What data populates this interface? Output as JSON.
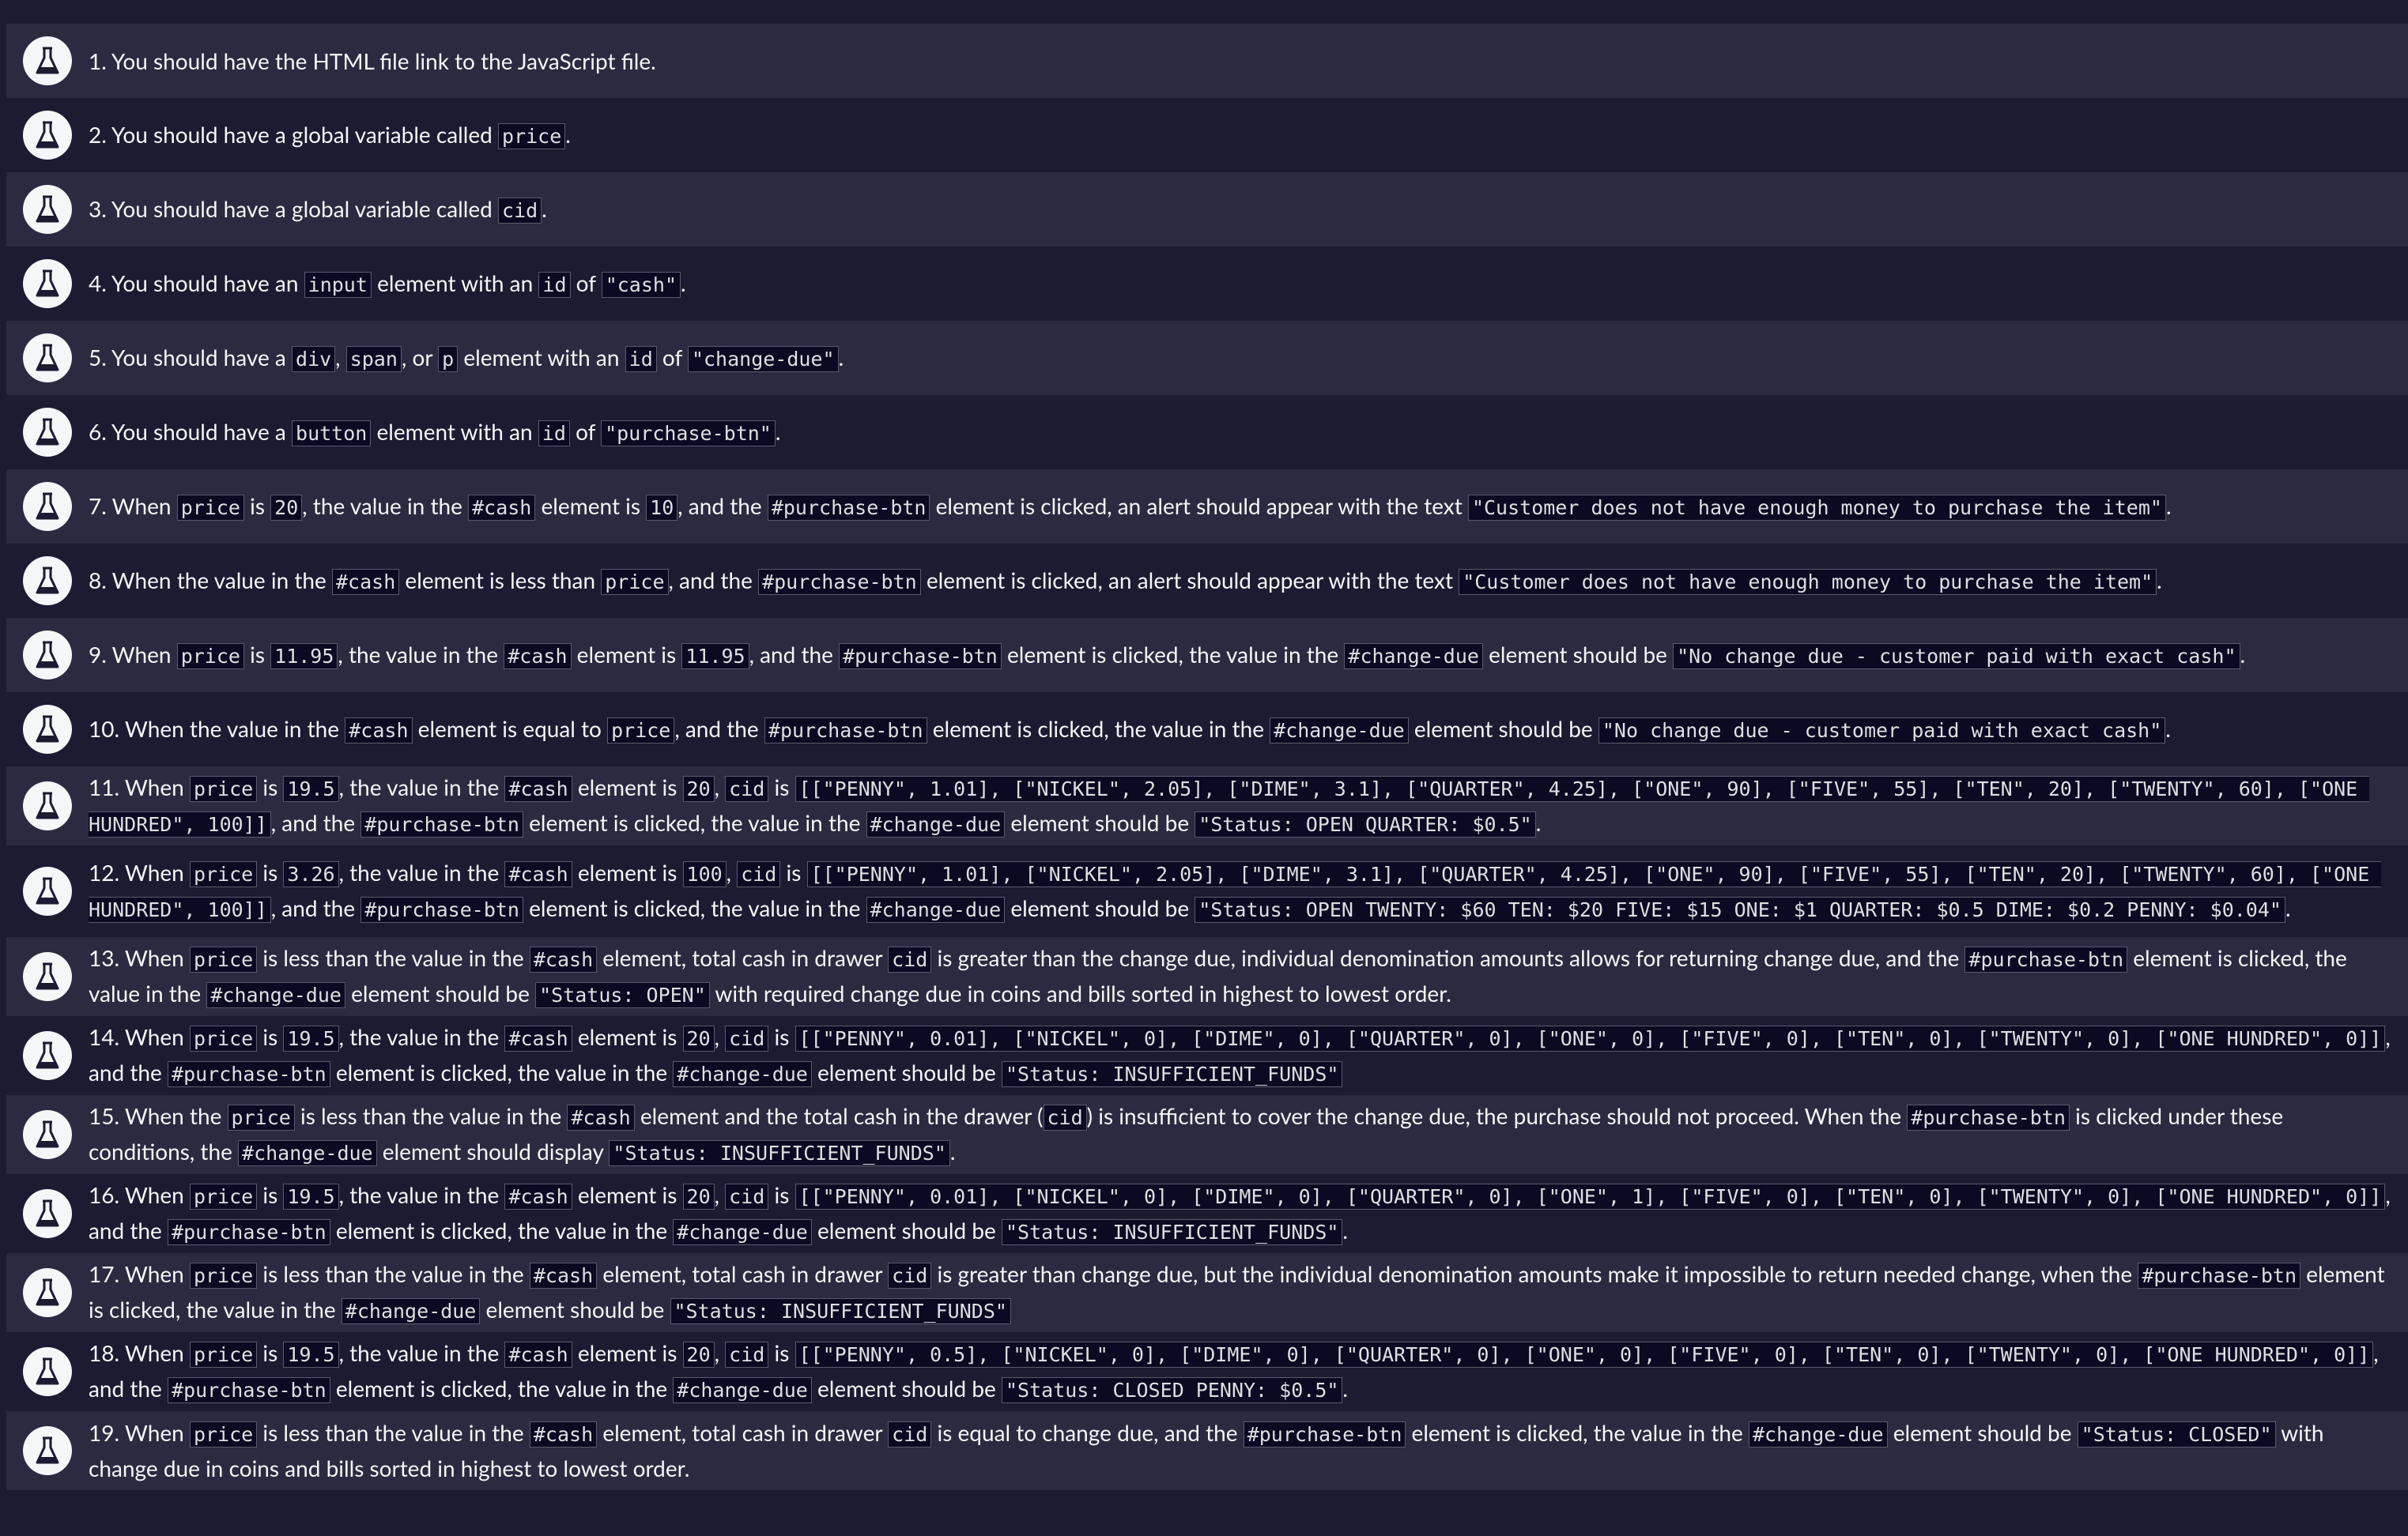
{
  "tests": [
    {
      "parts": [
        {
          "t": "text",
          "v": "1. You should have the HTML file link to the JavaScript file."
        }
      ]
    },
    {
      "parts": [
        {
          "t": "text",
          "v": "2. You should have a global variable called "
        },
        {
          "t": "code",
          "v": "price"
        },
        {
          "t": "text",
          "v": "."
        }
      ]
    },
    {
      "parts": [
        {
          "t": "text",
          "v": "3. You should have a global variable called "
        },
        {
          "t": "code",
          "v": "cid"
        },
        {
          "t": "text",
          "v": "."
        }
      ]
    },
    {
      "parts": [
        {
          "t": "text",
          "v": "4. You should have an "
        },
        {
          "t": "code",
          "v": "input"
        },
        {
          "t": "text",
          "v": " element with an "
        },
        {
          "t": "code",
          "v": "id"
        },
        {
          "t": "text",
          "v": " of "
        },
        {
          "t": "code",
          "v": "\"cash\""
        },
        {
          "t": "text",
          "v": "."
        }
      ]
    },
    {
      "parts": [
        {
          "t": "text",
          "v": "5. You should have a "
        },
        {
          "t": "code",
          "v": "div"
        },
        {
          "t": "text",
          "v": ", "
        },
        {
          "t": "code",
          "v": "span"
        },
        {
          "t": "text",
          "v": ", or "
        },
        {
          "t": "code",
          "v": "p"
        },
        {
          "t": "text",
          "v": " element with an "
        },
        {
          "t": "code",
          "v": "id"
        },
        {
          "t": "text",
          "v": " of "
        },
        {
          "t": "code",
          "v": "\"change-due\""
        },
        {
          "t": "text",
          "v": "."
        }
      ]
    },
    {
      "parts": [
        {
          "t": "text",
          "v": "6. You should have a "
        },
        {
          "t": "code",
          "v": "button"
        },
        {
          "t": "text",
          "v": " element with an "
        },
        {
          "t": "code",
          "v": "id"
        },
        {
          "t": "text",
          "v": " of "
        },
        {
          "t": "code",
          "v": "\"purchase-btn\""
        },
        {
          "t": "text",
          "v": "."
        }
      ]
    },
    {
      "parts": [
        {
          "t": "text",
          "v": "7. When "
        },
        {
          "t": "code",
          "v": "price"
        },
        {
          "t": "text",
          "v": " is "
        },
        {
          "t": "code",
          "v": "20"
        },
        {
          "t": "text",
          "v": ", the value in the "
        },
        {
          "t": "code",
          "v": "#cash"
        },
        {
          "t": "text",
          "v": " element is "
        },
        {
          "t": "code",
          "v": "10"
        },
        {
          "t": "text",
          "v": ", and the "
        },
        {
          "t": "code",
          "v": "#purchase-btn"
        },
        {
          "t": "text",
          "v": " element is clicked, an alert should appear with the text "
        },
        {
          "t": "code",
          "v": "\"Customer does not have enough money to purchase the item\""
        },
        {
          "t": "text",
          "v": "."
        }
      ]
    },
    {
      "parts": [
        {
          "t": "text",
          "v": "8. When the value in the "
        },
        {
          "t": "code",
          "v": "#cash"
        },
        {
          "t": "text",
          "v": " element is less than "
        },
        {
          "t": "code",
          "v": "price"
        },
        {
          "t": "text",
          "v": ", and the "
        },
        {
          "t": "code",
          "v": "#purchase-btn"
        },
        {
          "t": "text",
          "v": " element is clicked, an alert should appear with the text "
        },
        {
          "t": "code",
          "v": "\"Customer does not have enough money to purchase the item\""
        },
        {
          "t": "text",
          "v": "."
        }
      ]
    },
    {
      "parts": [
        {
          "t": "text",
          "v": "9. When "
        },
        {
          "t": "code",
          "v": "price"
        },
        {
          "t": "text",
          "v": " is "
        },
        {
          "t": "code",
          "v": "11.95"
        },
        {
          "t": "text",
          "v": ", the value in the "
        },
        {
          "t": "code",
          "v": "#cash"
        },
        {
          "t": "text",
          "v": " element is "
        },
        {
          "t": "code",
          "v": "11.95"
        },
        {
          "t": "text",
          "v": ", and the "
        },
        {
          "t": "code",
          "v": "#purchase-btn"
        },
        {
          "t": "text",
          "v": " element is clicked, the value in the "
        },
        {
          "t": "code",
          "v": "#change-due"
        },
        {
          "t": "text",
          "v": " element should be "
        },
        {
          "t": "code",
          "v": "\"No change due - customer paid with exact cash\""
        },
        {
          "t": "text",
          "v": "."
        }
      ]
    },
    {
      "parts": [
        {
          "t": "text",
          "v": "10. When the value in the "
        },
        {
          "t": "code",
          "v": "#cash"
        },
        {
          "t": "text",
          "v": " element is equal to "
        },
        {
          "t": "code",
          "v": "price"
        },
        {
          "t": "text",
          "v": ", and the "
        },
        {
          "t": "code",
          "v": "#purchase-btn"
        },
        {
          "t": "text",
          "v": " element is clicked, the value in the "
        },
        {
          "t": "code",
          "v": "#change-due"
        },
        {
          "t": "text",
          "v": " element should be "
        },
        {
          "t": "code",
          "v": "\"No change due - customer paid with exact cash\""
        },
        {
          "t": "text",
          "v": "."
        }
      ]
    },
    {
      "parts": [
        {
          "t": "text",
          "v": "11. When "
        },
        {
          "t": "code",
          "v": "price"
        },
        {
          "t": "text",
          "v": " is "
        },
        {
          "t": "code",
          "v": "19.5"
        },
        {
          "t": "text",
          "v": ", the value in the "
        },
        {
          "t": "code",
          "v": "#cash"
        },
        {
          "t": "text",
          "v": " element is "
        },
        {
          "t": "code",
          "v": "20"
        },
        {
          "t": "text",
          "v": ", "
        },
        {
          "t": "code",
          "v": "cid"
        },
        {
          "t": "text",
          "v": " is "
        },
        {
          "t": "code",
          "v": "[[\"PENNY\", 1.01], [\"NICKEL\", 2.05], [\"DIME\", 3.1], [\"QUARTER\", 4.25], [\"ONE\", 90], [\"FIVE\", 55], [\"TEN\", 20], [\"TWENTY\", 60], [\"ONE HUNDRED\", 100]]"
        },
        {
          "t": "text",
          "v": ", and the "
        },
        {
          "t": "code",
          "v": "#purchase-btn"
        },
        {
          "t": "text",
          "v": " element is clicked, the value in the "
        },
        {
          "t": "code",
          "v": "#change-due"
        },
        {
          "t": "text",
          "v": " element should be "
        },
        {
          "t": "code",
          "v": "\"Status: OPEN QUARTER: $0.5\""
        },
        {
          "t": "text",
          "v": "."
        }
      ]
    },
    {
      "parts": [
        {
          "t": "text",
          "v": "12. When "
        },
        {
          "t": "code",
          "v": "price"
        },
        {
          "t": "text",
          "v": " is "
        },
        {
          "t": "code",
          "v": "3.26"
        },
        {
          "t": "text",
          "v": ", the value in the "
        },
        {
          "t": "code",
          "v": "#cash"
        },
        {
          "t": "text",
          "v": " element is "
        },
        {
          "t": "code",
          "v": "100"
        },
        {
          "t": "text",
          "v": ", "
        },
        {
          "t": "code",
          "v": "cid"
        },
        {
          "t": "text",
          "v": " is "
        },
        {
          "t": "code",
          "v": "[[\"PENNY\", 1.01], [\"NICKEL\", 2.05], [\"DIME\", 3.1], [\"QUARTER\", 4.25], [\"ONE\", 90], [\"FIVE\", 55], [\"TEN\", 20], [\"TWENTY\", 60], [\"ONE HUNDRED\", 100]]"
        },
        {
          "t": "text",
          "v": ", and the "
        },
        {
          "t": "code",
          "v": "#purchase-btn"
        },
        {
          "t": "text",
          "v": " element is clicked, the value in the "
        },
        {
          "t": "code",
          "v": "#change-due"
        },
        {
          "t": "text",
          "v": " element should be "
        },
        {
          "t": "code",
          "v": "\"Status: OPEN TWENTY: $60 TEN: $20 FIVE: $15 ONE: $1 QUARTER: $0.5 DIME: $0.2 PENNY: $0.04\""
        },
        {
          "t": "text",
          "v": "."
        }
      ]
    },
    {
      "parts": [
        {
          "t": "text",
          "v": "13. When "
        },
        {
          "t": "code",
          "v": "price"
        },
        {
          "t": "text",
          "v": " is less than the value in the "
        },
        {
          "t": "code",
          "v": "#cash"
        },
        {
          "t": "text",
          "v": " element, total cash in drawer "
        },
        {
          "t": "code",
          "v": "cid"
        },
        {
          "t": "text",
          "v": " is greater than the change due, individual denomination amounts allows for returning change due, and the "
        },
        {
          "t": "code",
          "v": "#purchase-btn"
        },
        {
          "t": "text",
          "v": " element is clicked, the value in the "
        },
        {
          "t": "code",
          "v": "#change-due"
        },
        {
          "t": "text",
          "v": " element should be "
        },
        {
          "t": "code",
          "v": "\"Status: OPEN\""
        },
        {
          "t": "text",
          "v": " with required change due in coins and bills sorted in highest to lowest order."
        }
      ]
    },
    {
      "parts": [
        {
          "t": "text",
          "v": "14. When "
        },
        {
          "t": "code",
          "v": "price"
        },
        {
          "t": "text",
          "v": " is "
        },
        {
          "t": "code",
          "v": "19.5"
        },
        {
          "t": "text",
          "v": ", the value in the "
        },
        {
          "t": "code",
          "v": "#cash"
        },
        {
          "t": "text",
          "v": " element is "
        },
        {
          "t": "code",
          "v": "20"
        },
        {
          "t": "text",
          "v": ", "
        },
        {
          "t": "code",
          "v": "cid"
        },
        {
          "t": "text",
          "v": " is "
        },
        {
          "t": "code",
          "v": "[[\"PENNY\", 0.01], [\"NICKEL\", 0], [\"DIME\", 0], [\"QUARTER\", 0], [\"ONE\", 0], [\"FIVE\", 0], [\"TEN\", 0], [\"TWENTY\", 0], [\"ONE HUNDRED\", 0]]"
        },
        {
          "t": "text",
          "v": ", and the "
        },
        {
          "t": "code",
          "v": "#purchase-btn"
        },
        {
          "t": "text",
          "v": " element is clicked, the value in the "
        },
        {
          "t": "code",
          "v": "#change-due"
        },
        {
          "t": "text",
          "v": " element should be "
        },
        {
          "t": "code",
          "v": "\"Status: INSUFFICIENT_FUNDS\""
        }
      ]
    },
    {
      "parts": [
        {
          "t": "text",
          "v": "15. When the "
        },
        {
          "t": "code",
          "v": "price"
        },
        {
          "t": "text",
          "v": " is less than the value in the "
        },
        {
          "t": "code",
          "v": "#cash"
        },
        {
          "t": "text",
          "v": " element and the total cash in the drawer ("
        },
        {
          "t": "code",
          "v": "cid"
        },
        {
          "t": "text",
          "v": ") is insufficient to cover the change due, the purchase should not proceed. When the "
        },
        {
          "t": "code",
          "v": "#purchase-btn"
        },
        {
          "t": "text",
          "v": " is clicked under these conditions, the "
        },
        {
          "t": "code",
          "v": "#change-due"
        },
        {
          "t": "text",
          "v": " element should display "
        },
        {
          "t": "code",
          "v": "\"Status: INSUFFICIENT_FUNDS\""
        },
        {
          "t": "text",
          "v": "."
        }
      ]
    },
    {
      "parts": [
        {
          "t": "text",
          "v": "16. When "
        },
        {
          "t": "code",
          "v": "price"
        },
        {
          "t": "text",
          "v": " is "
        },
        {
          "t": "code",
          "v": "19.5"
        },
        {
          "t": "text",
          "v": ", the value in the "
        },
        {
          "t": "code",
          "v": "#cash"
        },
        {
          "t": "text",
          "v": " element is "
        },
        {
          "t": "code",
          "v": "20"
        },
        {
          "t": "text",
          "v": ", "
        },
        {
          "t": "code",
          "v": "cid"
        },
        {
          "t": "text",
          "v": " is "
        },
        {
          "t": "code",
          "v": "[[\"PENNY\", 0.01], [\"NICKEL\", 0], [\"DIME\", 0], [\"QUARTER\", 0], [\"ONE\", 1], [\"FIVE\", 0], [\"TEN\", 0], [\"TWENTY\", 0], [\"ONE HUNDRED\", 0]]"
        },
        {
          "t": "text",
          "v": ", and the "
        },
        {
          "t": "code",
          "v": "#purchase-btn"
        },
        {
          "t": "text",
          "v": " element is clicked, the value in the "
        },
        {
          "t": "code",
          "v": "#change-due"
        },
        {
          "t": "text",
          "v": " element should be "
        },
        {
          "t": "code",
          "v": "\"Status: INSUFFICIENT_FUNDS\""
        },
        {
          "t": "text",
          "v": "."
        }
      ]
    },
    {
      "parts": [
        {
          "t": "text",
          "v": "17. When "
        },
        {
          "t": "code",
          "v": "price"
        },
        {
          "t": "text",
          "v": " is less than the value in the "
        },
        {
          "t": "code",
          "v": "#cash"
        },
        {
          "t": "text",
          "v": " element, total cash in drawer "
        },
        {
          "t": "code",
          "v": "cid"
        },
        {
          "t": "text",
          "v": " is greater than change due, but the individual denomination amounts make it impossible to return needed change, when the "
        },
        {
          "t": "code",
          "v": "#purchase-btn"
        },
        {
          "t": "text",
          "v": " element is clicked, the value in the "
        },
        {
          "t": "code",
          "v": "#change-due"
        },
        {
          "t": "text",
          "v": " element should be "
        },
        {
          "t": "code",
          "v": "\"Status: INSUFFICIENT_FUNDS\""
        }
      ]
    },
    {
      "parts": [
        {
          "t": "text",
          "v": "18. When "
        },
        {
          "t": "code",
          "v": "price"
        },
        {
          "t": "text",
          "v": " is "
        },
        {
          "t": "code",
          "v": "19.5"
        },
        {
          "t": "text",
          "v": ", the value in the "
        },
        {
          "t": "code",
          "v": "#cash"
        },
        {
          "t": "text",
          "v": " element is "
        },
        {
          "t": "code",
          "v": "20"
        },
        {
          "t": "text",
          "v": ", "
        },
        {
          "t": "code",
          "v": "cid"
        },
        {
          "t": "text",
          "v": " is "
        },
        {
          "t": "code",
          "v": "[[\"PENNY\", 0.5], [\"NICKEL\", 0], [\"DIME\", 0], [\"QUARTER\", 0], [\"ONE\", 0], [\"FIVE\", 0], [\"TEN\", 0], [\"TWENTY\", 0], [\"ONE HUNDRED\", 0]]"
        },
        {
          "t": "text",
          "v": ", and the "
        },
        {
          "t": "code",
          "v": "#purchase-btn"
        },
        {
          "t": "text",
          "v": " element is clicked, the value in the "
        },
        {
          "t": "code",
          "v": "#change-due"
        },
        {
          "t": "text",
          "v": " element should be "
        },
        {
          "t": "code",
          "v": "\"Status: CLOSED PENNY: $0.5\""
        },
        {
          "t": "text",
          "v": "."
        }
      ]
    },
    {
      "parts": [
        {
          "t": "text",
          "v": "19. When "
        },
        {
          "t": "code",
          "v": "price"
        },
        {
          "t": "text",
          "v": " is less than the value in the "
        },
        {
          "t": "code",
          "v": "#cash"
        },
        {
          "t": "text",
          "v": " element, total cash in drawer "
        },
        {
          "t": "code",
          "v": "cid"
        },
        {
          "t": "text",
          "v": " is equal to change due, and the "
        },
        {
          "t": "code",
          "v": "#purchase-btn"
        },
        {
          "t": "text",
          "v": " element is clicked, the value in the "
        },
        {
          "t": "code",
          "v": "#change-due"
        },
        {
          "t": "text",
          "v": " element should be "
        },
        {
          "t": "code",
          "v": "\"Status: CLOSED\""
        },
        {
          "t": "text",
          "v": " with change due in coins and bills sorted in highest to lowest order."
        }
      ]
    }
  ],
  "icon": "test-flask-icon"
}
